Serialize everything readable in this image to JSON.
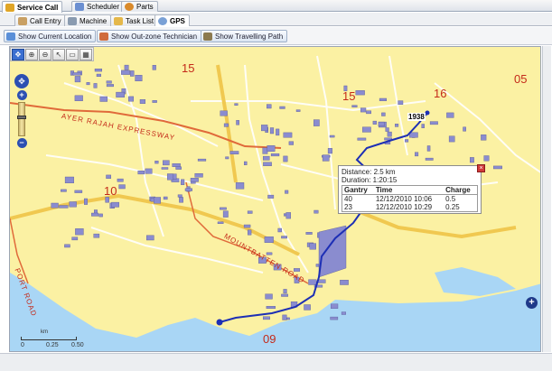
{
  "main_tabs": [
    {
      "label": "Service Call",
      "icon": "service-call-icon",
      "active": true
    },
    {
      "label": "Scheduler",
      "icon": "calendar-icon",
      "active": false
    },
    {
      "label": "Parts",
      "icon": "parts-icon",
      "active": false
    }
  ],
  "sub_tabs": [
    {
      "label": "Call Entry",
      "icon": "call-entry-icon",
      "active": false
    },
    {
      "label": "Machine",
      "icon": "machine-icon",
      "active": false
    },
    {
      "label": "Task List",
      "icon": "task-list-icon",
      "active": false
    },
    {
      "label": "GPS",
      "icon": "gps-icon",
      "active": true
    }
  ],
  "toolbar": {
    "show_current_location": "Show Current Location",
    "show_outzone_technician": "Show Out-zone Technician",
    "show_travelling_path": "Show Travelling Path"
  },
  "map": {
    "zone_labels": [
      "15",
      "15",
      "16",
      "05",
      "10",
      "09"
    ],
    "road_labels": [
      "AYER RAJAH EXPRESSWAY",
      "MOUNTBATTEN ROAD",
      "PORT ROAD"
    ],
    "marker_label": "1938",
    "colors": {
      "land": "#fbf1a3",
      "sea": "#a9d6f5",
      "expressway": "#e06a3a",
      "building": "#8a8ccf",
      "path": "#1d2fb5"
    }
  },
  "popup": {
    "distance": "Distance: 2.5 km",
    "duration": "Duration: 1:20:15",
    "headers": [
      "Gantry",
      "Time",
      "Charge"
    ],
    "rows": [
      [
        "40",
        "12/12/2010 10:06",
        "0.5"
      ],
      [
        "23",
        "12/12/2010 10:29",
        "0.25"
      ]
    ]
  },
  "scale": {
    "unit": "km",
    "ticks": [
      "0",
      "0.25",
      "0.50"
    ]
  }
}
